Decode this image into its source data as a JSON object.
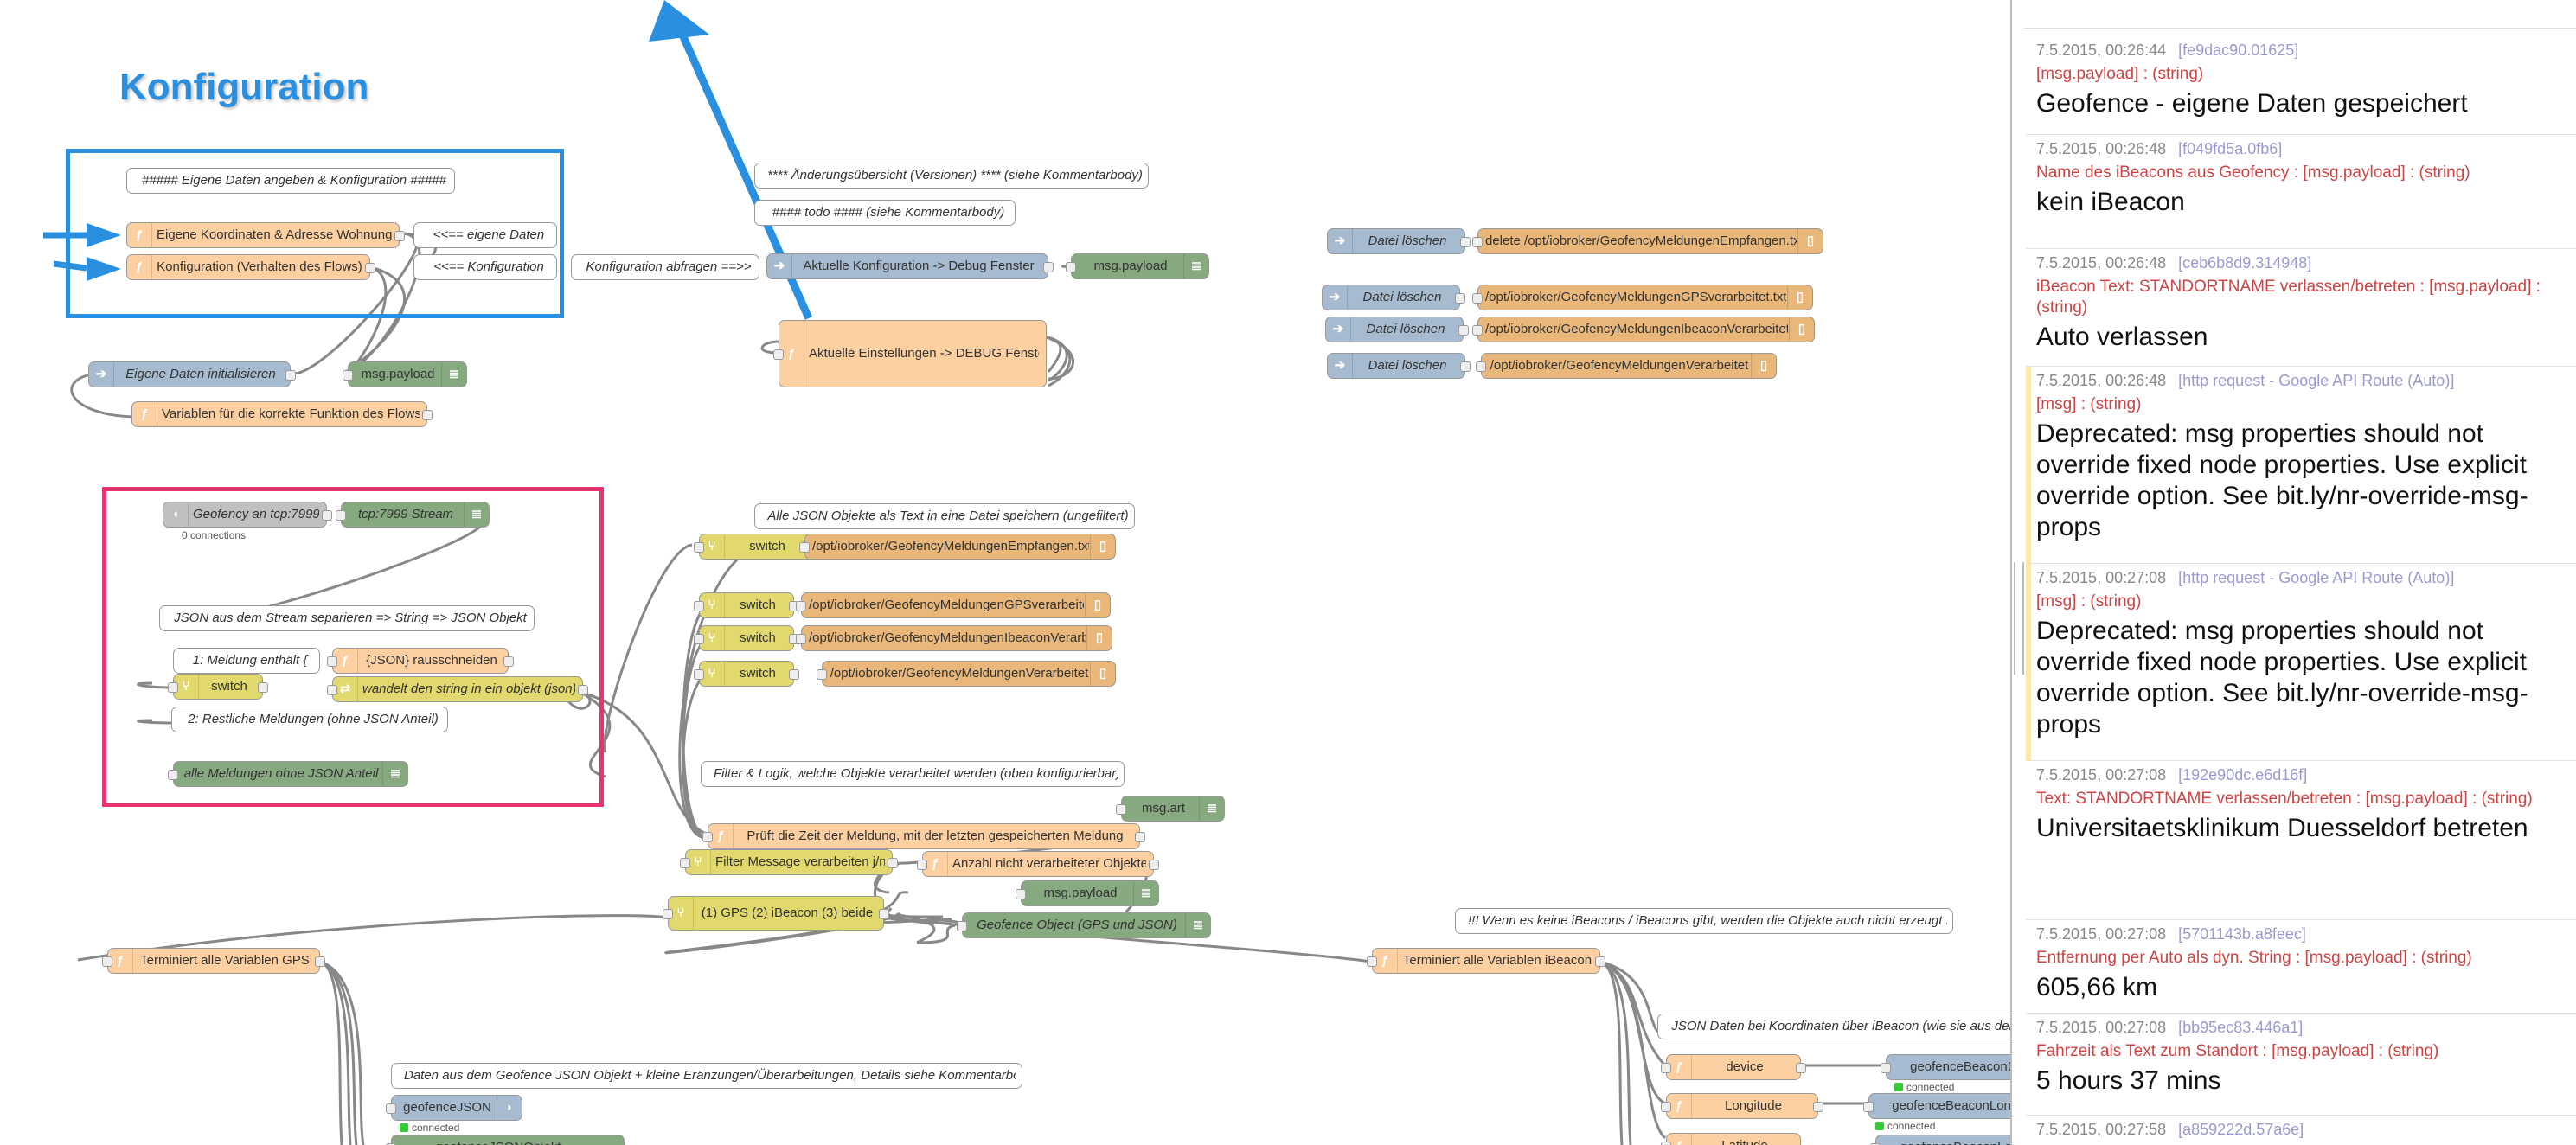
{
  "canvas": {
    "title": "Konfiguration",
    "nodes": {
      "c_eigene": "##### Eigene Daten angeben & Konfiguration #####",
      "f_koord": "Eigene Koordinaten & Adresse Wohnung",
      "f_konfig": "Konfiguration (Verhalten des Flows)",
      "c_eigene_daten": "<<== eigene Daten",
      "c_konfiguration": "<<== Konfiguration",
      "c_abfragen": "Konfiguration abfragen ==>>",
      "i_init": "Eigene Daten initialisieren",
      "d_payload1": "msg.payload",
      "f_variablen": "Variablen für die korrekte Funktion des Flows",
      "c_aenderung": "**** Änderungsübersicht (Versionen) **** (siehe Kommentarbody)",
      "c_todo": "#### todo #### (siehe Kommentarbody)",
      "i_aktuell": "Aktuelle Konfiguration -> Debug Fenster",
      "d_payload2": "msg.payload",
      "f_einstellungen": "Aktuelle Einstellungen -> DEBUG Fenster",
      "i_del1": "Datei löschen",
      "file_del1": "delete /opt/iobroker/GeofencyMeldungenEmpfangen.txt",
      "i_del2": "Datei löschen",
      "file_del2": "/opt/iobroker/GeofencyMeldungenGPSverarbeitet.txt",
      "i_del3": "Datei löschen",
      "file_del3": "/opt/iobroker/GeofencyMeldungenIbeaconVerarbeitet",
      "i_del4": "Datei löschen",
      "file_del4": "/opt/iobroker/GeofencyMeldungenVerarbeitet",
      "tcp_in": "Geofency an tcp:7999",
      "tcp_status": "0 connections",
      "d_tcp": "tcp:7999 Stream",
      "c_json_sep": "JSON aus dem Stream separieren => String => JSON Objekt",
      "c_meldung1": "1: Meldung enthält {",
      "f_rausschneiden": "{JSON} rausschneiden",
      "sw_switch1": "switch",
      "ch_wandelt": "wandelt den string in ein objekt (json)",
      "c_restliche": "2: Restliche Meldungen (ohne JSON Anteil)",
      "d_alle": "alle Meldungen ohne JSON Anteil",
      "c_alle_json": "Alle JSON Objekte als Text in eine Datei speichern (ungefiltert)",
      "sw_a": "switch",
      "file_a": "/opt/iobroker/GeofencyMeldungenEmpfangen.txt",
      "sw_b": "switch",
      "file_b": "/opt/iobroker/GeofencyMeldungenGPSverarbeitet.txt",
      "sw_c": "switch",
      "file_c": "/opt/iobroker/GeofencyMeldungenIbeaconVerarbeitet",
      "sw_d": "switch",
      "file_d": "/opt/iobroker/GeofencyMeldungenVerarbeitet",
      "c_filter": "Filter & Logik, welche Objekte verarbeitet werden (oben konfigurierbar)",
      "f_prueft": "Prüft die Zeit der Meldung, mit der letzten gespeicherten Meldung",
      "d_art": "msg.art",
      "sw_filter": "Filter Message verarbeiten j/n",
      "f_anzahl": "Anzahl nicht verarbeiteter Objekte",
      "d_payload3": "msg.payload",
      "sw_gps": "(1) GPS (2) iBeacon (3) beide",
      "d_geofence_obj": "Geofence Object (GPS und JSON)",
      "c_keine": "!!! Wenn es keine iBeacons / iBeacons gibt, werden die Objekte auch nicht erzeugt !!!",
      "f_term_gps": "Terminiert alle Variablen GPS",
      "f_term_ibeacon": "Terminiert alle Variablen iBeacon",
      "c_json_koord": "JSON Daten bei Koordinaten über iBeacon (wie sie aus der",
      "f_device": "device",
      "o_beacon_de": "geofenceBeaconDe",
      "st_connected1": "connected",
      "f_longitude": "Longitude",
      "o_beacon_long": "geofenceBeaconLongit",
      "st_connected2": "connected",
      "f_latitude": "Latitude",
      "o_beacon_lat": "geofenceBeaconLatit",
      "c_daten_aus": "Daten aus dem Geofence JSON Objekt + kleine Eränzungen/Überarbeitungen, Details siehe Kommentarbody",
      "o_geofence_json": "geofenceJSON",
      "st_connected3": "connected",
      "o_bottom": "geofenceJSONObjekt"
    }
  },
  "debug": {
    "messages": [
      {
        "time": "7.5.2015, 00:26:44",
        "source": "[fe9dac90.01625]",
        "topic": "[msg.payload] : (string)",
        "payload": "Geofence - eigene Daten gespeichert",
        "warn": false
      },
      {
        "time": "7.5.2015, 00:26:48",
        "source": "[f049fd5a.0fb6]",
        "topic": "Name des iBeacons aus Geofency : [msg.payload] : (string)",
        "payload": "kein iBeacon",
        "warn": false
      },
      {
        "time": "7.5.2015, 00:26:48",
        "source": "[ceb6b8d9.314948]",
        "topic": "iBeacon Text: STANDORTNAME verlassen/betreten : [msg.payload] : (string)",
        "payload": "Auto verlassen",
        "warn": false
      },
      {
        "time": "7.5.2015, 00:26:48",
        "source": "[http request - Google API Route (Auto)]",
        "topic": "[msg] : (string)",
        "payload": "Deprecated: msg properties should not override fixed node properties. Use explicit override option. See bit.ly/nr-override-msg-props",
        "warn": true
      },
      {
        "time": "7.5.2015, 00:27:08",
        "source": "[http request - Google API Route (Auto)]",
        "topic": "[msg] : (string)",
        "payload": "Deprecated: msg properties should not override fixed node properties. Use explicit override option. See bit.ly/nr-override-msg-props",
        "warn": true
      },
      {
        "time": "7.5.2015, 00:27:08",
        "source": "[192e90dc.e6d16f]",
        "topic": "Text: STANDORTNAME verlassen/betreten : [msg.payload] : (string)",
        "payload": "Universitaetsklinikum Duesseldorf betreten",
        "warn": false
      },
      {
        "time": "7.5.2015, 00:27:08",
        "source": "[5701143b.a8feec]",
        "topic": "Entfernung per Auto als dyn. String : [msg.payload] : (string)",
        "payload": "605,66 km",
        "warn": false
      },
      {
        "time": "7.5.2015, 00:27:08",
        "source": "[bb95ec83.446a1]",
        "topic": "Fahrzeit als Text zum Standort : [msg.payload] : (string)",
        "payload": "5 hours 37 mins",
        "warn": false
      },
      {
        "time": "7.5.2015, 00:27:58",
        "source": "[a859222d.57a6e]",
        "topic": "",
        "payload": "",
        "warn": false
      }
    ]
  },
  "colors": {
    "function": "#fdd0a2",
    "inject": "#a6bbcf",
    "debug": "#87a980",
    "switch": "#e2d96e",
    "file": "#e8b779",
    "selection_blue": "#2a8fdf",
    "selection_pink": "#e8336d"
  }
}
